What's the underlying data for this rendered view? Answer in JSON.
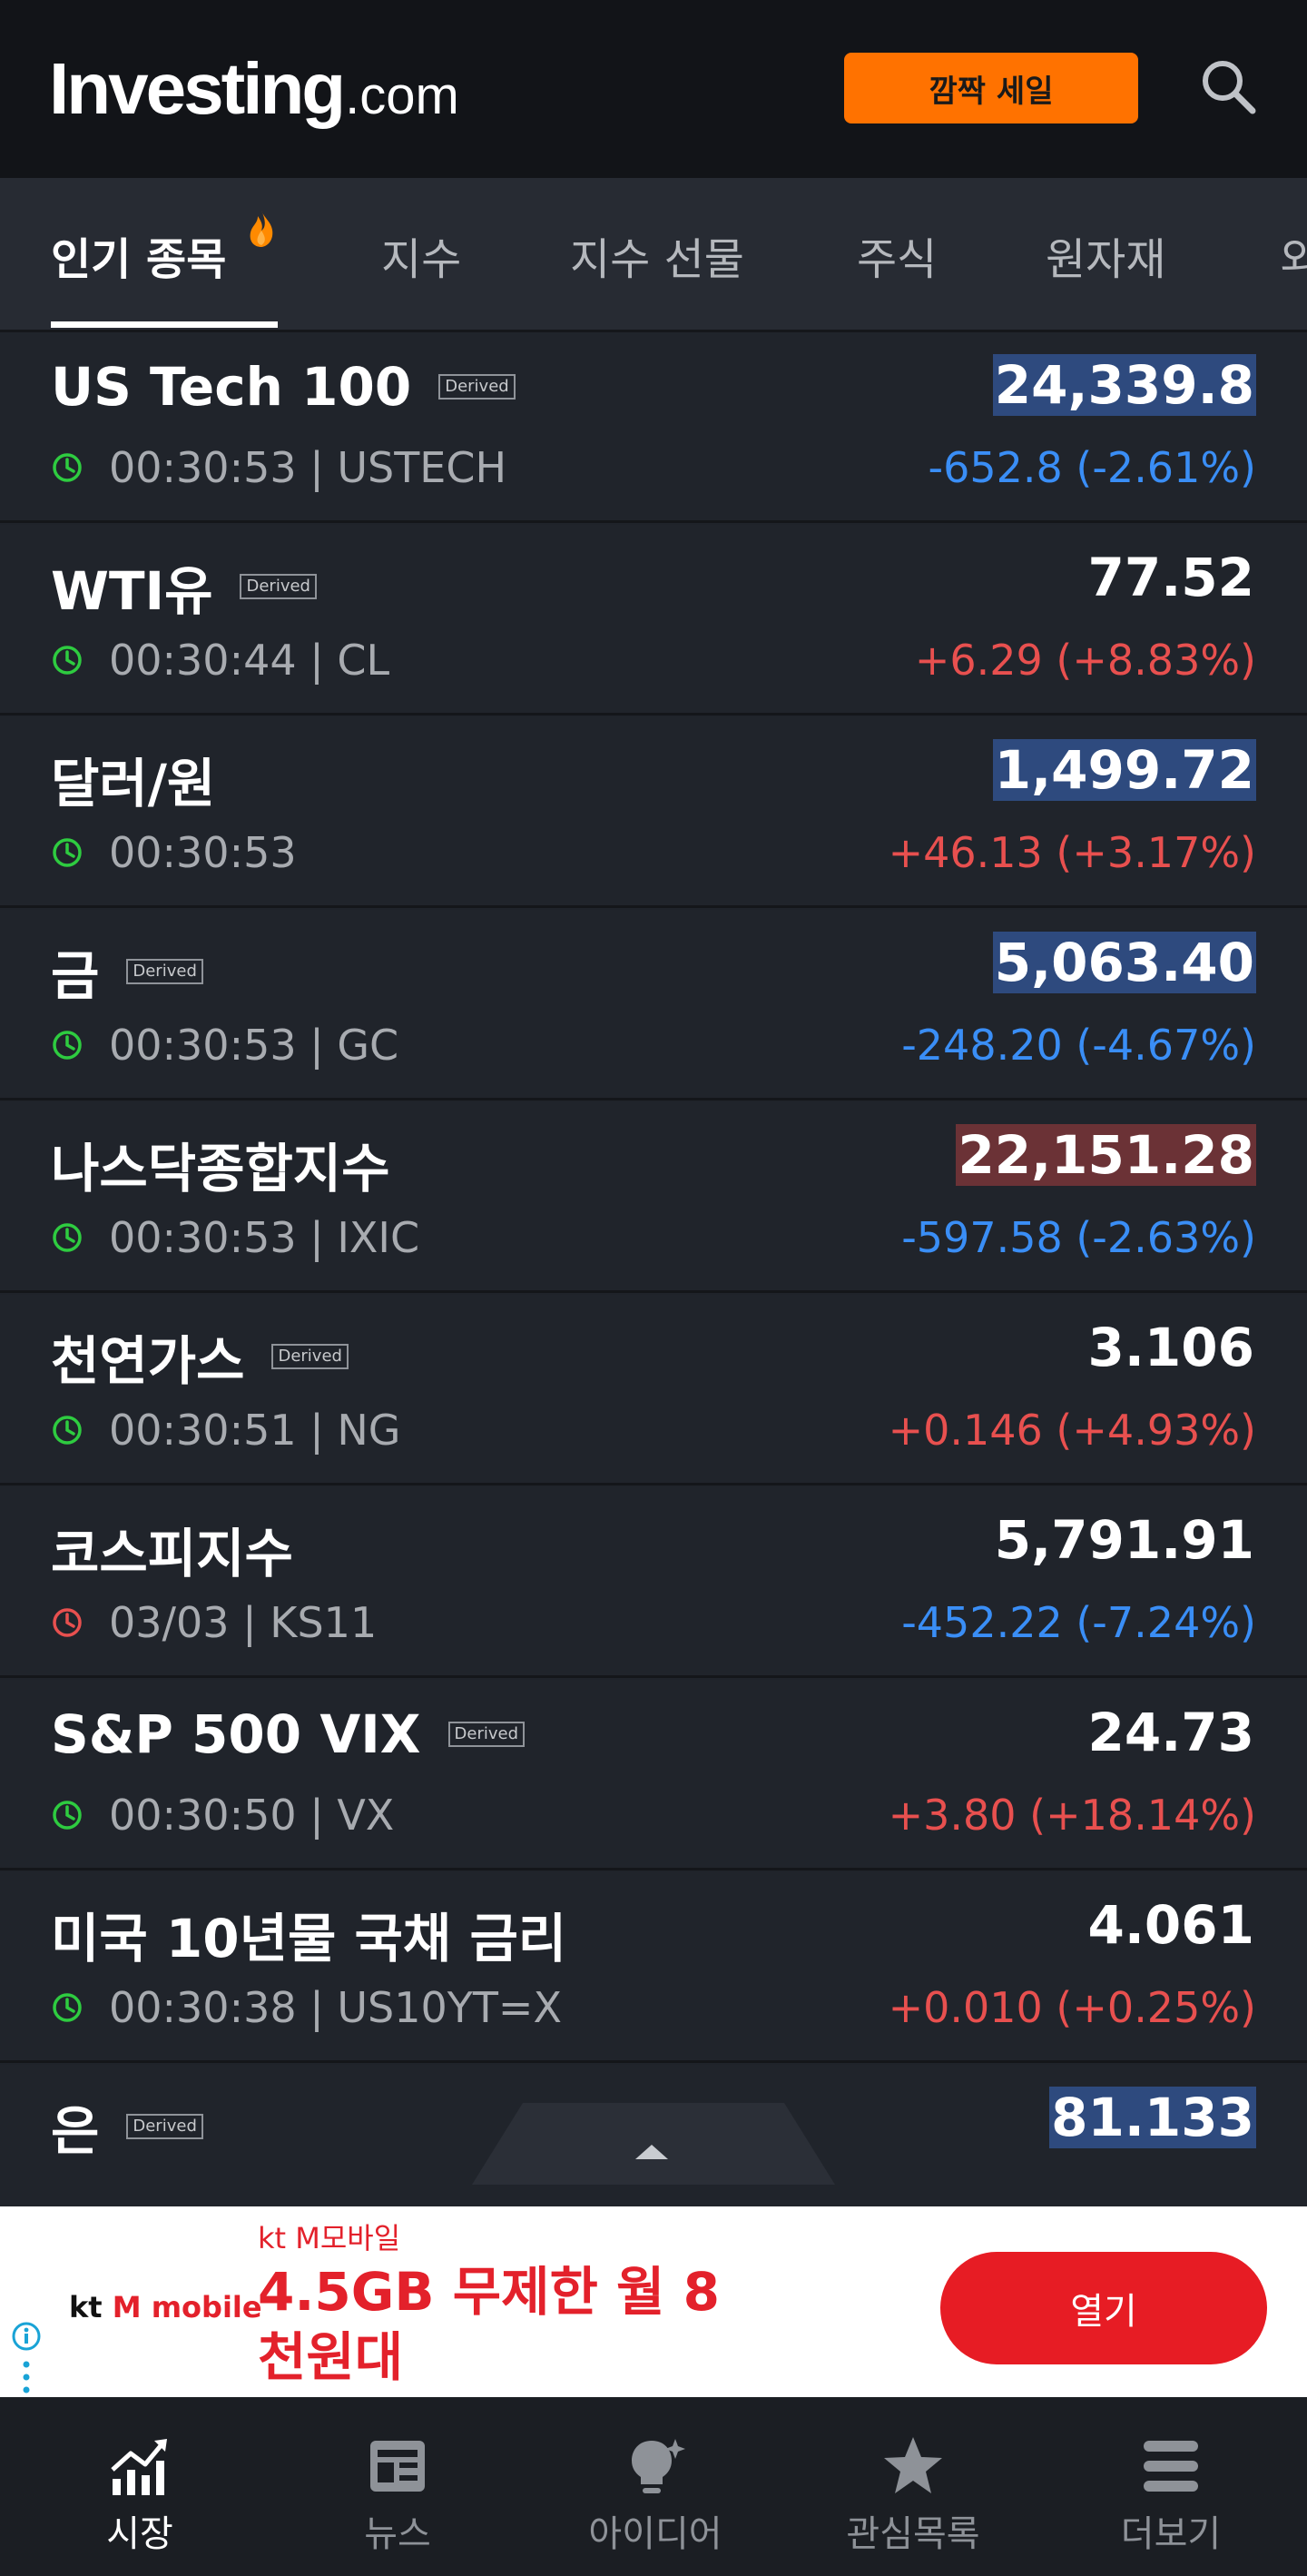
{
  "header": {
    "logo_main": "Investing",
    "logo_domain": ".com",
    "sale_button": "깜짝 세일",
    "search_icon": "search-icon"
  },
  "tabs": [
    {
      "label": "인기 종목",
      "active": true
    },
    {
      "label": "지수"
    },
    {
      "label": "지수 선물"
    },
    {
      "label": "주식"
    },
    {
      "label": "원자재"
    },
    {
      "label": "외"
    }
  ],
  "derived_label": "Derived",
  "rows": [
    {
      "name": "US Tech 100",
      "derived": true,
      "time": "00:30:53 | USTECH",
      "price": "24,339.8",
      "change": "-652.8 (-2.61%)",
      "direction": "down",
      "highlight": "blue",
      "clock": "green"
    },
    {
      "name": "WTI유",
      "derived": true,
      "time": "00:30:44 | CL",
      "price": "77.52",
      "change": "+6.29 (+8.83%)",
      "direction": "up",
      "highlight": "",
      "clock": "green"
    },
    {
      "name": "달러/원",
      "derived": false,
      "time": "00:30:53",
      "price": "1,499.72",
      "change": "+46.13 (+3.17%)",
      "direction": "up",
      "highlight": "blue",
      "clock": "green"
    },
    {
      "name": "금",
      "derived": true,
      "time": "00:30:53 | GC",
      "price": "5,063.40",
      "change": "-248.20 (-4.67%)",
      "direction": "down",
      "highlight": "blue",
      "clock": "green"
    },
    {
      "name": "나스닥종합지수",
      "derived": false,
      "time": "00:30:53 | IXIC",
      "price": "22,151.28",
      "change": "-597.58 (-2.63%)",
      "direction": "down",
      "highlight": "red",
      "clock": "green"
    },
    {
      "name": "천연가스",
      "derived": true,
      "time": "00:30:51 | NG",
      "price": "3.106",
      "change": "+0.146 (+4.93%)",
      "direction": "up",
      "highlight": "",
      "clock": "green"
    },
    {
      "name": "코스피지수",
      "derived": false,
      "time": "03/03 | KS11",
      "price": "5,791.91",
      "change": "-452.22 (-7.24%)",
      "direction": "down",
      "highlight": "",
      "clock": "red"
    },
    {
      "name": "S&P 500 VIX",
      "derived": true,
      "time": "00:30:50 | VX",
      "price": "24.73",
      "change": "+3.80 (+18.14%)",
      "direction": "up",
      "highlight": "",
      "clock": "green"
    },
    {
      "name": "미국 10년물 국채 금리",
      "derived": false,
      "time": "00:30:38 | US10YT=X",
      "price": "4.061",
      "change": "+0.010 (+0.25%)",
      "direction": "up",
      "highlight": "",
      "clock": "green"
    },
    {
      "name": "은",
      "derived": true,
      "time": "",
      "price": "81.133",
      "change": "",
      "direction": "up",
      "highlight": "blue",
      "clock": "green"
    }
  ],
  "ad": {
    "logo_kt": "kt",
    "logo_mobile": "M mobile",
    "sub": "kt M모바일",
    "headline": "4.5GB 무제한 월 8 천원대",
    "open_button": "열기"
  },
  "bottom_nav": [
    {
      "label": "시장",
      "icon": "chart-icon",
      "active": true
    },
    {
      "label": "뉴스",
      "icon": "news-icon"
    },
    {
      "label": "아이디어",
      "icon": "idea-icon"
    },
    {
      "label": "관심목록",
      "icon": "star-icon"
    },
    {
      "label": "더보기",
      "icon": "menu-icon"
    }
  ],
  "colors": {
    "accent_orange": "#ff7200",
    "down_blue": "#3a8ef6",
    "up_red": "#e8504f",
    "clock_green": "#2ecc40",
    "clock_red": "#e8504f"
  }
}
